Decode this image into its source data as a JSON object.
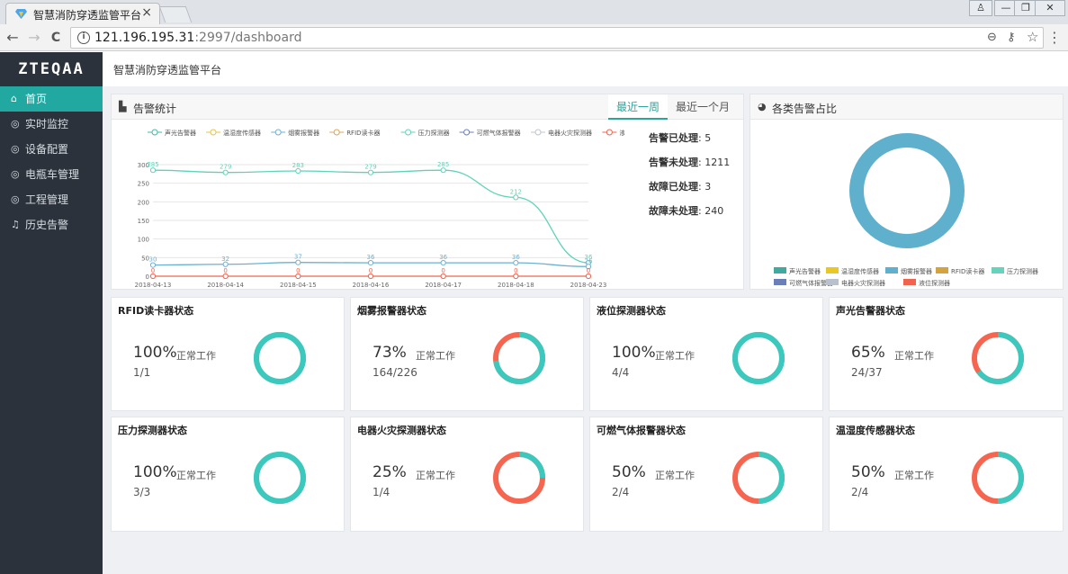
{
  "browser": {
    "tab_title": "智慧消防穿透监管平台",
    "tab_close": "×",
    "url_host": "121.196.195.31",
    "url_rest": ":2997/dashboard",
    "nav": {
      "back": "←",
      "forward": "→",
      "reload": "C"
    },
    "window_controls": {
      "user": "♙",
      "minimize": "—",
      "maximize": "❐",
      "close": "✕"
    },
    "omni_icons": {
      "zoom": "⊖",
      "key": "⚷",
      "star": "☆",
      "menu": "⋮"
    }
  },
  "app": {
    "logo": "ZTEQAA",
    "page_title": "智慧消防穿透监管平台",
    "menu": [
      {
        "label": "首页",
        "icon": "home-icon",
        "glyph": "⌂",
        "active": true
      },
      {
        "label": "实时监控",
        "icon": "monitor-icon",
        "glyph": "◎"
      },
      {
        "label": "设备配置",
        "icon": "settings-icon",
        "glyph": "◎"
      },
      {
        "label": "电瓶车管理",
        "icon": "bike-icon",
        "glyph": "◎"
      },
      {
        "label": "工程管理",
        "icon": "project-icon",
        "glyph": "◎"
      },
      {
        "label": "历史告警",
        "icon": "bell-icon",
        "glyph": "♫"
      }
    ]
  },
  "alarm_panel": {
    "title": "告警统计",
    "tabs": [
      "最近一周",
      "最近一个月"
    ],
    "active_tab": 0,
    "stats": [
      {
        "label": "告警已处理",
        "value": "5"
      },
      {
        "label": "告警未处理",
        "value": "1211"
      },
      {
        "label": "故障已处理",
        "value": "3"
      },
      {
        "label": "故障未处理",
        "value": "240"
      }
    ]
  },
  "pie_panel": {
    "title": "各类告警占比"
  },
  "chart_data": [
    {
      "type": "line",
      "x": [
        "2018-04-13",
        "2018-04-14",
        "2018-04-15",
        "2018-04-16",
        "2018-04-17",
        "2018-04-18",
        "2018-04-23"
      ],
      "ylim": [
        0,
        300
      ],
      "yticks": [
        0,
        50,
        100,
        150,
        200,
        250,
        300
      ],
      "grid": true,
      "legend_position": "top",
      "legend": [
        "声光告警器",
        "温湿度传感器",
        "烟雾报警器",
        "RFID读卡器",
        "压力探测器",
        "可燃气体报警器",
        "电器火灾探测器",
        "液位探测器"
      ],
      "series": [
        {
          "name": "压力探测器",
          "color": "#5fd3b8",
          "values": [
            285,
            279,
            283,
            279,
            285,
            212,
            36
          ],
          "labels": true
        },
        {
          "name": "烟雾报警器",
          "color": "#6cb1d4",
          "values": [
            30,
            32,
            37,
            36,
            36,
            36,
            26
          ],
          "labels": true
        },
        {
          "name": "液位探测器",
          "color": "#f0634e",
          "values": [
            0,
            0,
            0,
            0,
            0,
            0,
            0
          ],
          "labels": true
        }
      ],
      "legend_colors": [
        "#41b8a8",
        "#e6c542",
        "#6cb1d4",
        "#e0a458",
        "#5fd3b8",
        "#6a7fc1",
        "#bfc5cc",
        "#f0634e"
      ]
    },
    {
      "type": "pie",
      "legend_position": "bottom",
      "labels": [
        "声光告警器",
        "温湿度传感器",
        "烟雾报警器",
        "RFID读卡器",
        "压力探测器",
        "可燃气体报警器",
        "电器火灾探测器",
        "液位探测器"
      ],
      "colors": [
        "#41aaa0",
        "#e9c826",
        "#5fb0cc",
        "#d4a23e",
        "#66d3bd",
        "#6a7fb8",
        "#b9c2cc",
        "#f0634e"
      ],
      "values": [
        0,
        0,
        100,
        0,
        0,
        0,
        0,
        0
      ]
    }
  ],
  "status_cards": [
    {
      "title": "RFID读卡器状态",
      "pct": "100%",
      "pct_label": "正常工作",
      "ratio": "1/1",
      "fraction": 1.0
    },
    {
      "title": "烟雾报警器状态",
      "pct": "73%",
      "pct_label": "正常工作",
      "ratio": "164/226",
      "fraction": 0.73
    },
    {
      "title": "液位探测器状态",
      "pct": "100%",
      "pct_label": "正常工作",
      "ratio": "4/4",
      "fraction": 1.0
    },
    {
      "title": "声光告警器状态",
      "pct": "65%",
      "pct_label": "正常工作",
      "ratio": "24/37",
      "fraction": 0.65
    },
    {
      "title": "压力探测器状态",
      "pct": "100%",
      "pct_label": "正常工作",
      "ratio": "3/3",
      "fraction": 1.0
    },
    {
      "title": "电器火灾探测器状态",
      "pct": "25%",
      "pct_label": "正常工作",
      "ratio": "1/4",
      "fraction": 0.25
    },
    {
      "title": "可燃气体报警器状态",
      "pct": "50%",
      "pct_label": "正常工作",
      "ratio": "2/4",
      "fraction": 0.5
    },
    {
      "title": "温湿度传感器状态",
      "pct": "50%",
      "pct_label": "正常工作",
      "ratio": "2/4",
      "fraction": 0.5
    }
  ],
  "colors": {
    "ok": "#3cc8bd",
    "fault": "#f5654f",
    "accent": "#21a8a0",
    "sidebar": "#2b323b"
  }
}
